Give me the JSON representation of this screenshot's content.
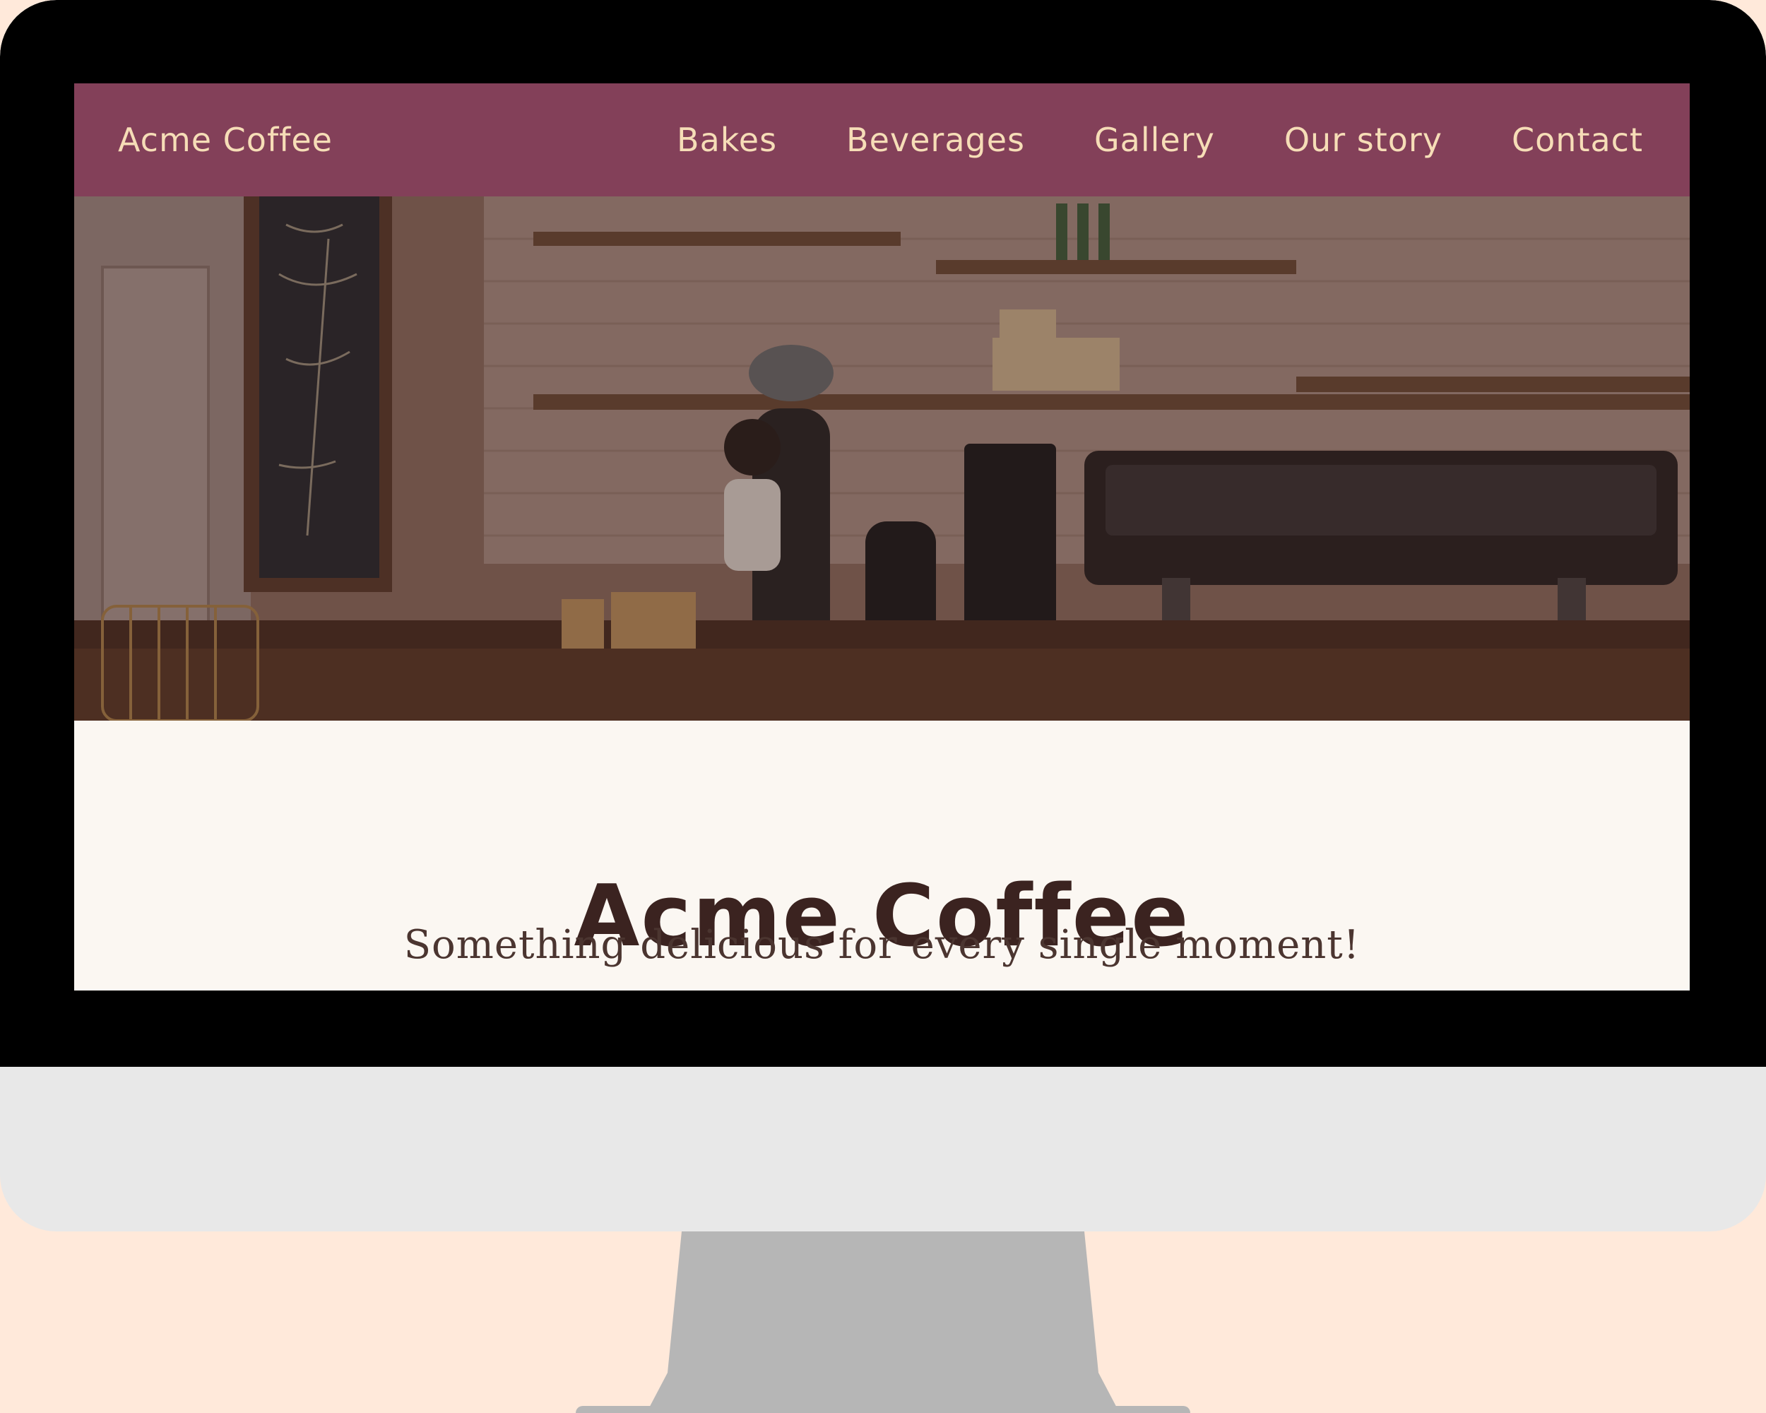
{
  "site": {
    "brand": "Acme Coffee",
    "nav": [
      "Bakes",
      "Beverages",
      "Gallery",
      "Our story",
      "Contact"
    ]
  },
  "hero": {
    "title": "Acme Coffee",
    "subtitle": "Something delicious for every single moment!"
  },
  "colors": {
    "page_background": "#FFE9DA",
    "nav_background": "#834059",
    "nav_text": "#F6DDB7",
    "content_background": "#FBF7F2",
    "title_text": "#3B2320",
    "monitor_bezel": "#000000",
    "monitor_chin": "#E8E8E8",
    "stand": "#B6B6B6"
  }
}
